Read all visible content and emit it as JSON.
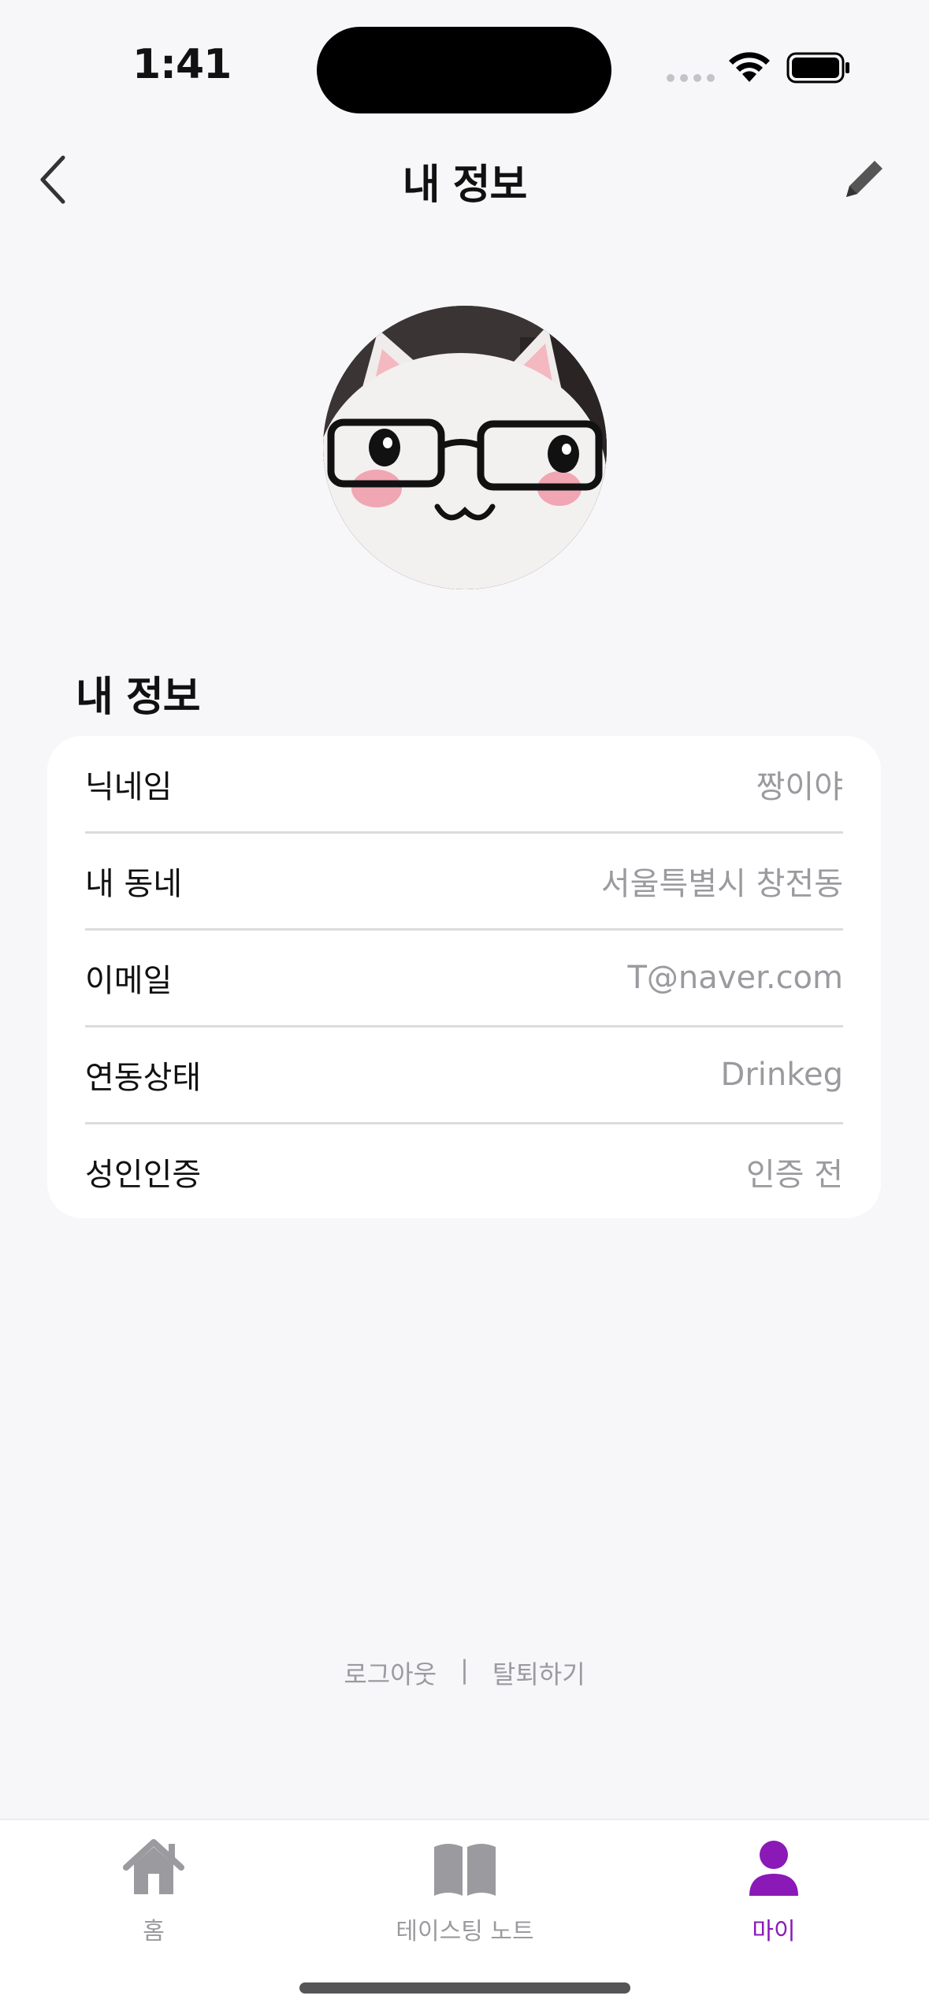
{
  "status_bar": {
    "time": "1:41"
  },
  "nav": {
    "title": "내 정보",
    "back_icon": "chevron-left-icon",
    "edit_icon": "pencil-icon"
  },
  "section": {
    "title": "내 정보"
  },
  "info_rows": [
    {
      "label": "닉네임",
      "value": "짱이야"
    },
    {
      "label": "내 동네",
      "value": "서울특별시 창전동"
    },
    {
      "label": "이메일",
      "value": "T@naver.com"
    },
    {
      "label": "연동상태",
      "value": "Drinkeg"
    },
    {
      "label": "성인인증",
      "value": "인증 전"
    }
  ],
  "footer": {
    "logout": "로그아웃",
    "separator": "|",
    "withdraw": "탈퇴하기"
  },
  "tabs": [
    {
      "label": "홈",
      "icon": "home-icon",
      "active": false
    },
    {
      "label": "테이스팅 노트",
      "icon": "book-icon",
      "active": false
    },
    {
      "label": "마이",
      "icon": "person-icon",
      "active": true
    }
  ],
  "colors": {
    "accent": "#8a19b8",
    "inactive": "#9a9a9f",
    "background": "#f7f7f9"
  }
}
